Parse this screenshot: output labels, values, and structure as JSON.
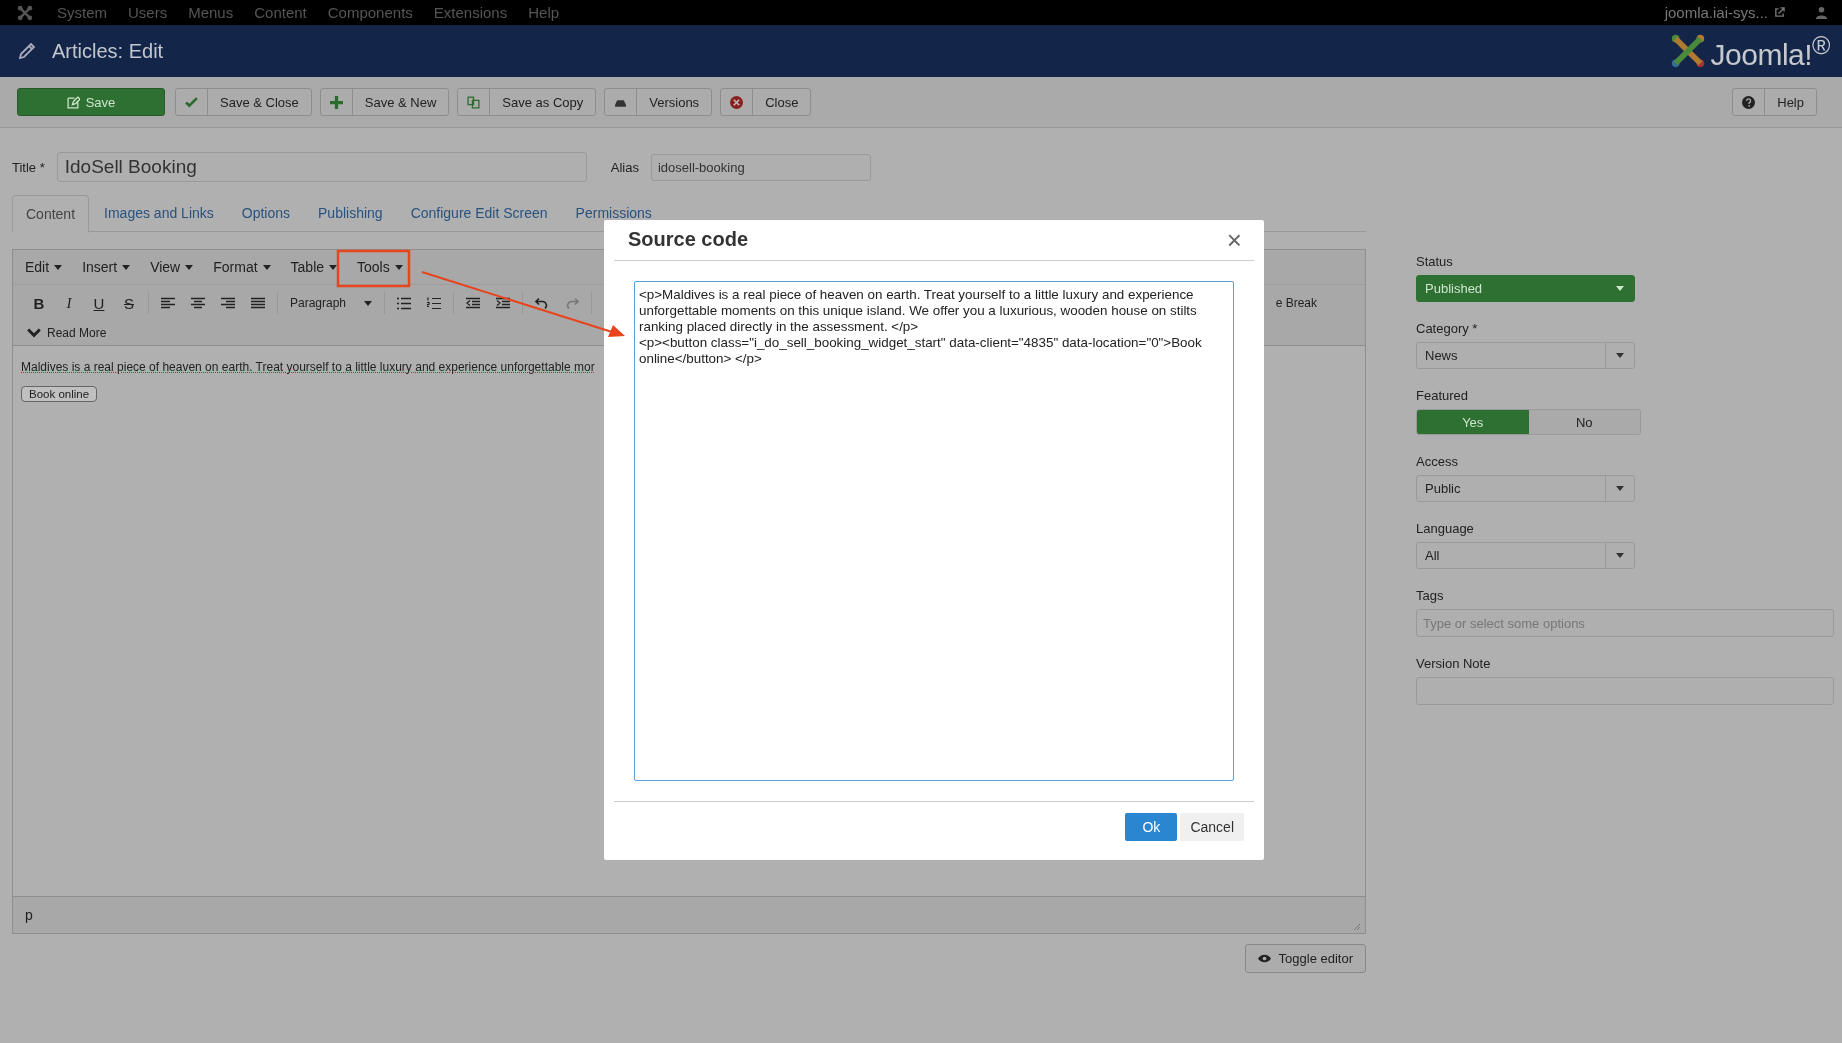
{
  "top_menu": {
    "items": [
      "System",
      "Users",
      "Menus",
      "Content",
      "Components",
      "Extensions",
      "Help"
    ],
    "site_link": "joomla.iai-sys..."
  },
  "header": {
    "title": "Articles: Edit",
    "logo": "Joomla!$^{®}$"
  },
  "toolbar": {
    "buttons": [
      {
        "label": "Save",
        "kind": "save"
      },
      {
        "label": "Save & Close",
        "kind": "check"
      },
      {
        "label": "Save & New",
        "kind": "plus"
      },
      {
        "label": "Save as Copy",
        "kind": "copy"
      },
      {
        "label": "Versions",
        "kind": "versions"
      },
      {
        "label": "Close",
        "kind": "close"
      }
    ],
    "help": "Help"
  },
  "title_field": {
    "label": "Title *",
    "value": "IdoSell Booking"
  },
  "alias_field": {
    "label": "Alias",
    "value": "idosell-booking"
  },
  "tabs": [
    {
      "label": "Content",
      "selected": true
    },
    {
      "label": "Images and Links",
      "selected": false
    },
    {
      "label": "Options",
      "selected": false
    },
    {
      "label": "Publishing",
      "selected": false
    },
    {
      "label": "Configure Edit Screen",
      "selected": false
    },
    {
      "label": "Permissions",
      "selected": false
    }
  ],
  "editor": {
    "menus": [
      {
        "label": "Edit"
      },
      {
        "label": "Insert"
      },
      {
        "label": "View"
      },
      {
        "label": "Format"
      },
      {
        "label": "Table"
      },
      {
        "label": "Tools"
      }
    ],
    "format_buttons": [
      "B",
      "I",
      "U",
      "S"
    ],
    "block_format": "Paragraph",
    "toolbar_tail": "e Break",
    "read_more": "Read More",
    "content_text": "Maldives is a real piece of heaven on earth. Treat yourself to a little luxury and experience unforgettable mor",
    "content_button": "Book online",
    "path": "p"
  },
  "toggle_editor": "Toggle editor",
  "sidebar": [
    {
      "kind": "select",
      "label": "Status",
      "value": "Published",
      "highlighted": true
    },
    {
      "kind": "select",
      "label": "Category *",
      "value": "News",
      "highlighted": false
    },
    {
      "kind": "toggle",
      "label": "Featured",
      "options": [
        {
          "label": "Yes",
          "selected": true
        },
        {
          "label": "No",
          "selected": false
        }
      ]
    },
    {
      "kind": "select",
      "label": "Access",
      "value": "Public",
      "highlighted": false
    },
    {
      "kind": "select",
      "label": "Language",
      "value": "All",
      "highlighted": false
    },
    {
      "kind": "text",
      "label": "Tags",
      "placeholder": "Type or select some options"
    },
    {
      "kind": "text",
      "label": "Version Note"
    }
  ],
  "modal": {
    "title": "Source code",
    "close": "×",
    "source": "<p>Maldives is a real piece of heaven on earth. Treat yourself to a little luxury and experience unforgettable moments on this unique island. We offer you a luxurious, wooden house on stilts ranking placed directly in the assessment. </p>\n<p><button class=\"i_do_sell_booking_widget_start\" data-client=\"4835\" data-location=\"0\">Book online</button> </p>",
    "buttons": [
      {
        "label": "Ok",
        "kind": "primary"
      },
      {
        "label": "Cancel",
        "kind": "secondary"
      }
    ]
  }
}
